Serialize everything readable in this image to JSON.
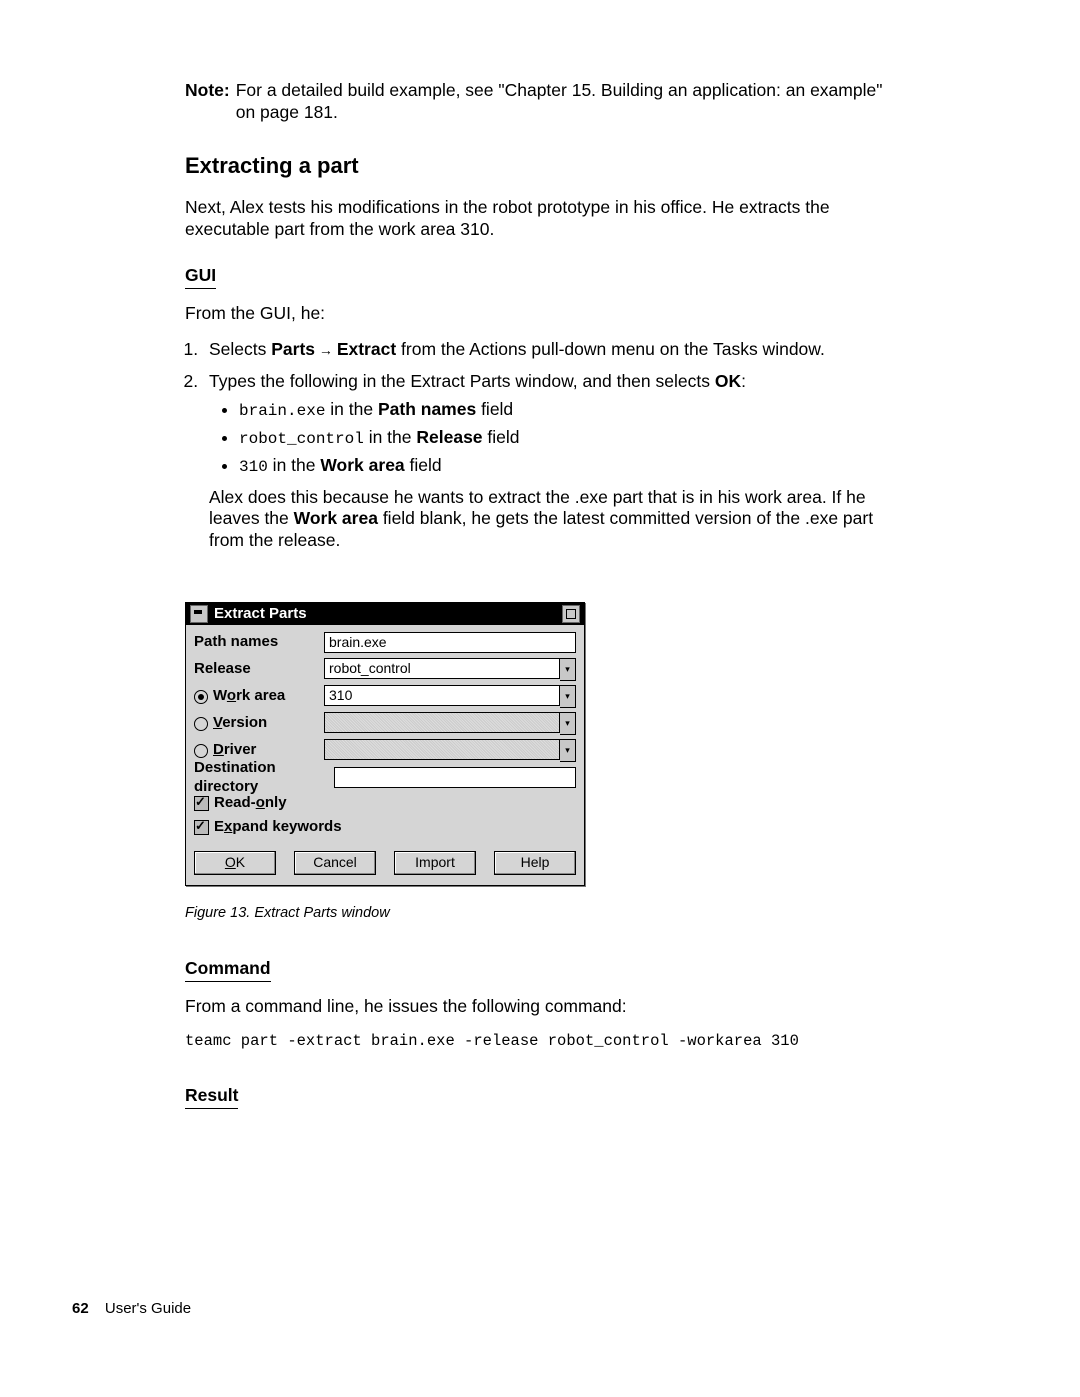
{
  "note": {
    "label": "Note:",
    "text": "For a detailed build example, see \"Chapter 15. Building an application: an example\" on page 181."
  },
  "section_title": "Extracting a part",
  "intro": "Next, Alex tests his modifications in the robot prototype in his office. He extracts the executable part from the work area 310.",
  "gui": {
    "heading": "GUI",
    "lead": "From the GUI, he:",
    "step1": {
      "pre": "Selects ",
      "parts": "Parts",
      "arrow": " → ",
      "extract": "Extract",
      "post": " from the Actions pull-down menu on the Tasks window."
    },
    "step2": {
      "pre": "Types the following in the Extract Parts window, and then selects ",
      "ok": "OK",
      "post": ":"
    },
    "bullets": {
      "b1": {
        "code": "brain.exe",
        "mid": " in the ",
        "bold": "Path names",
        "post": " field"
      },
      "b2": {
        "code": "robot_control",
        "mid": " in the ",
        "bold": "Release",
        "post": " field"
      },
      "b3": {
        "code": "310",
        "mid": " in the ",
        "bold": "Work area",
        "post": " field"
      }
    },
    "after": {
      "t1": "Alex does this because he wants to extract the .exe part that is in his work area. If he leaves the ",
      "bold": "Work area",
      "t2": " field blank, he gets the latest committed version of the .exe part from the release."
    }
  },
  "dialog": {
    "title": "Extract Parts",
    "rows": {
      "path_names": {
        "label": "Path names",
        "value": "brain.exe"
      },
      "release": {
        "label": "Release",
        "value": "robot_control"
      },
      "work_area": {
        "label_pre": "W",
        "label_u": "o",
        "label_post": "rk area",
        "value": "310"
      },
      "version": {
        "label_u": "V",
        "label_post": "ersion",
        "value": ""
      },
      "driver": {
        "label_u": "D",
        "label_post": "river",
        "value": ""
      },
      "dest": {
        "label": "Destination directory",
        "value": ""
      }
    },
    "checks": {
      "readonly": {
        "pre": "Read-",
        "u": "o",
        "post": "nly"
      },
      "expand": {
        "pre": "E",
        "u": "x",
        "post": "pand keywords"
      }
    },
    "buttons": {
      "ok": "OK",
      "ok_u": "O",
      "ok_post": "K",
      "cancel": "Cancel",
      "import": "Import",
      "help": "Help"
    }
  },
  "figure_caption": "Figure 13. Extract Parts window",
  "command": {
    "heading": "Command",
    "lead": "From a command line, he issues the following command:",
    "code": "teamc part -extract brain.exe -release robot_control -workarea 310"
  },
  "result_heading": "Result",
  "footer": {
    "page": "62",
    "title": "User's Guide"
  }
}
